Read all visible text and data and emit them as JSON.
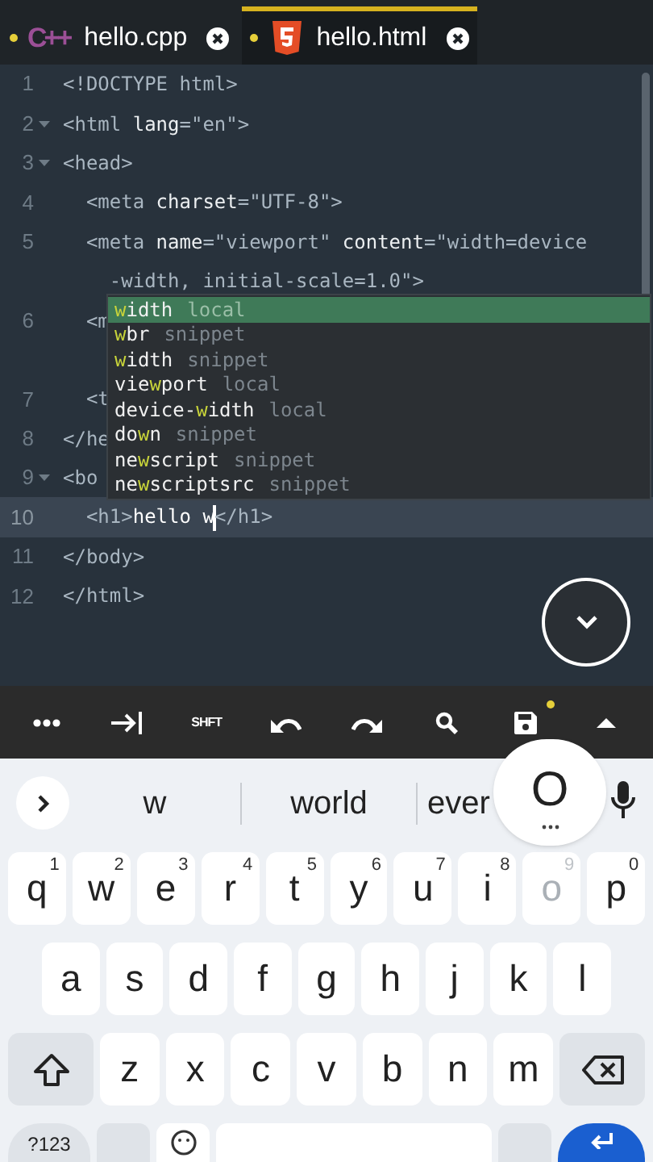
{
  "tabs": [
    {
      "kind": "cpp",
      "logo_text": "C++",
      "label": "hello.cpp",
      "modified": true,
      "selected": false
    },
    {
      "kind": "html5",
      "label": "hello.html",
      "modified": true,
      "selected": true
    }
  ],
  "editor": {
    "rows": [
      {
        "kind": "line",
        "number": "1",
        "fold": false,
        "segments": [
          {
            "text": "<!DOCTYPE html>",
            "kind": "tag"
          }
        ]
      },
      {
        "kind": "line",
        "number": "2",
        "fold": true,
        "segments": [
          {
            "text": "<html",
            "kind": "tag"
          },
          {
            "text": " lang",
            "kind": "attr"
          },
          {
            "text": "=\"en\">",
            "kind": "tag"
          }
        ]
      },
      {
        "kind": "line",
        "number": "3",
        "fold": true,
        "segments": [
          {
            "text": "<head>",
            "kind": "tag"
          }
        ]
      },
      {
        "kind": "line",
        "number": "4",
        "fold": false,
        "segments": [
          {
            "text": "  <meta",
            "kind": "tag"
          },
          {
            "text": " charset",
            "kind": "attr"
          },
          {
            "text": "=\"UTF-8\">",
            "kind": "tag"
          }
        ]
      },
      {
        "kind": "line",
        "number": "5",
        "fold": false,
        "segments": [
          {
            "text": "  <meta",
            "kind": "tag"
          },
          {
            "text": " name",
            "kind": "attr"
          },
          {
            "text": "=\"viewport\"",
            "kind": "tag"
          },
          {
            "text": " content",
            "kind": "attr"
          },
          {
            "text": "=\"width=device",
            "kind": "tag"
          }
        ]
      },
      {
        "kind": "wrap",
        "segments": [
          {
            "text": "    -width, initial-scale=1.0\">",
            "kind": "tag"
          }
        ]
      },
      {
        "kind": "line",
        "number": "6",
        "fold": false,
        "segments": [
          {
            "text": "  <m",
            "kind": "tag"
          }
        ]
      },
      {
        "kind": "wrap"
      },
      {
        "kind": "line",
        "number": "7",
        "fold": false,
        "segments": [
          {
            "text": "  <t",
            "kind": "tag"
          }
        ]
      },
      {
        "kind": "line",
        "number": "8",
        "fold": false,
        "segments": [
          {
            "text": "</he",
            "kind": "tag"
          }
        ]
      },
      {
        "kind": "line",
        "number": "9",
        "fold": true,
        "segments": [
          {
            "text": "<bo",
            "kind": "tag"
          }
        ]
      },
      {
        "kind": "line",
        "number": "10",
        "fold": false,
        "current": true,
        "segments": [
          {
            "text": "  <h1>",
            "kind": "tag"
          },
          {
            "text": "hello w",
            "kind": "text",
            "caret_after": true
          },
          {
            "text": "</h1>",
            "kind": "tag"
          }
        ]
      },
      {
        "kind": "line",
        "number": "11",
        "fold": false,
        "segments": [
          {
            "text": "</body>",
            "kind": "tag"
          }
        ]
      },
      {
        "kind": "line",
        "number": "12",
        "fold": false,
        "segments": [
          {
            "text": "</html>",
            "kind": "tag"
          }
        ]
      }
    ],
    "completions": [
      {
        "match": "w",
        "after": "idth",
        "source": "local",
        "selected": true
      },
      {
        "match": "w",
        "after": "br",
        "source": "snippet",
        "selected": false
      },
      {
        "match": "w",
        "after": "idth",
        "source": "snippet",
        "selected": false
      },
      {
        "before": "vie",
        "match": "w",
        "after": "port",
        "source": "local",
        "selected": false
      },
      {
        "before": "device-",
        "match": "w",
        "after": "idth",
        "source": "local",
        "selected": false
      },
      {
        "before": "do",
        "match": "w",
        "after": "n",
        "source": "snippet",
        "selected": false
      },
      {
        "before": "ne",
        "match": "w",
        "after": "script",
        "source": "snippet",
        "selected": false
      },
      {
        "before": "ne",
        "match": "w",
        "after": "scriptsrc",
        "source": "snippet",
        "selected": false
      }
    ]
  },
  "toolbar": [
    {
      "kind": "more"
    },
    {
      "kind": "tab"
    },
    {
      "kind": "text",
      "label": "SHFT"
    },
    {
      "kind": "undo"
    },
    {
      "kind": "redo"
    },
    {
      "kind": "search"
    },
    {
      "kind": "save",
      "unsaved": true
    },
    {
      "kind": "up"
    }
  ],
  "suggestions": [
    "w",
    "world",
    "ever"
  ],
  "key_preview": {
    "label": "O"
  },
  "keyboard": [
    [
      {
        "kind": "letter",
        "label": "q",
        "hint": "1"
      },
      {
        "kind": "letter",
        "label": "w",
        "hint": "2"
      },
      {
        "kind": "letter",
        "label": "e",
        "hint": "3"
      },
      {
        "kind": "letter",
        "label": "r",
        "hint": "4"
      },
      {
        "kind": "letter",
        "label": "t",
        "hint": "5"
      },
      {
        "kind": "letter",
        "label": "y",
        "hint": "6"
      },
      {
        "kind": "letter",
        "label": "u",
        "hint": "7"
      },
      {
        "kind": "letter",
        "label": "i",
        "hint": "8"
      },
      {
        "kind": "letter",
        "label": "o",
        "hint": "9",
        "pressed": true
      },
      {
        "kind": "letter",
        "label": "p",
        "hint": "0"
      }
    ],
    [
      {
        "kind": "letter",
        "label": "a"
      },
      {
        "kind": "letter",
        "label": "s"
      },
      {
        "kind": "letter",
        "label": "d"
      },
      {
        "kind": "letter",
        "label": "f"
      },
      {
        "kind": "letter",
        "label": "g"
      },
      {
        "kind": "letter",
        "label": "h"
      },
      {
        "kind": "letter",
        "label": "j"
      },
      {
        "kind": "letter",
        "label": "k"
      },
      {
        "kind": "letter",
        "label": "l"
      }
    ],
    [
      {
        "kind": "shift"
      },
      {
        "kind": "letter",
        "label": "z"
      },
      {
        "kind": "letter",
        "label": "x"
      },
      {
        "kind": "letter",
        "label": "c"
      },
      {
        "kind": "letter",
        "label": "v"
      },
      {
        "kind": "letter",
        "label": "b"
      },
      {
        "kind": "letter",
        "label": "n"
      },
      {
        "kind": "letter",
        "label": "m"
      },
      {
        "kind": "backspace"
      }
    ],
    [
      {
        "kind": "symbols",
        "label": "?123"
      },
      {
        "kind": "blank"
      },
      {
        "kind": "emoji"
      },
      {
        "kind": "space"
      },
      {
        "kind": "blank"
      },
      {
        "kind": "enter"
      }
    ]
  ]
}
